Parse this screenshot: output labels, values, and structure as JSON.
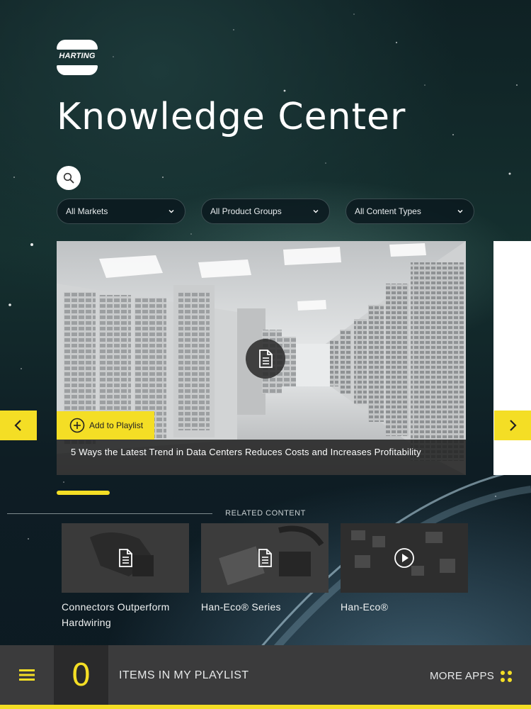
{
  "brand": {
    "logo_text": "HARTING"
  },
  "page_title": "Knowledge Center",
  "filters": [
    {
      "label": "All Markets"
    },
    {
      "label": "All Product Groups"
    },
    {
      "label": "All Content Types"
    }
  ],
  "hero": {
    "add_to_playlist": "Add to Playlist",
    "caption": "5 Ways the Latest Trend in Data Centers Reduces Costs and Increases Profitability",
    "content_type_icon": "document-icon",
    "carousel_progress": 0.13
  },
  "related": {
    "label": "RELATED CONTENT",
    "items": [
      {
        "title_line1": "Connectors Outperform",
        "title_line2": "Hardwiring",
        "icon": "document-icon"
      },
      {
        "title_line1": "Han-Eco® Series",
        "title_line2": "",
        "icon": "document-icon"
      },
      {
        "title_line1": "Han-Eco®",
        "title_line2": "",
        "icon": "play-icon"
      }
    ]
  },
  "bottom_bar": {
    "playlist_count": "0",
    "playlist_label": "ITEMS IN MY PLAYLIST",
    "more_apps": "MORE APPS"
  },
  "colors": {
    "accent": "#f4de25",
    "bar": "#3b3b3c"
  }
}
